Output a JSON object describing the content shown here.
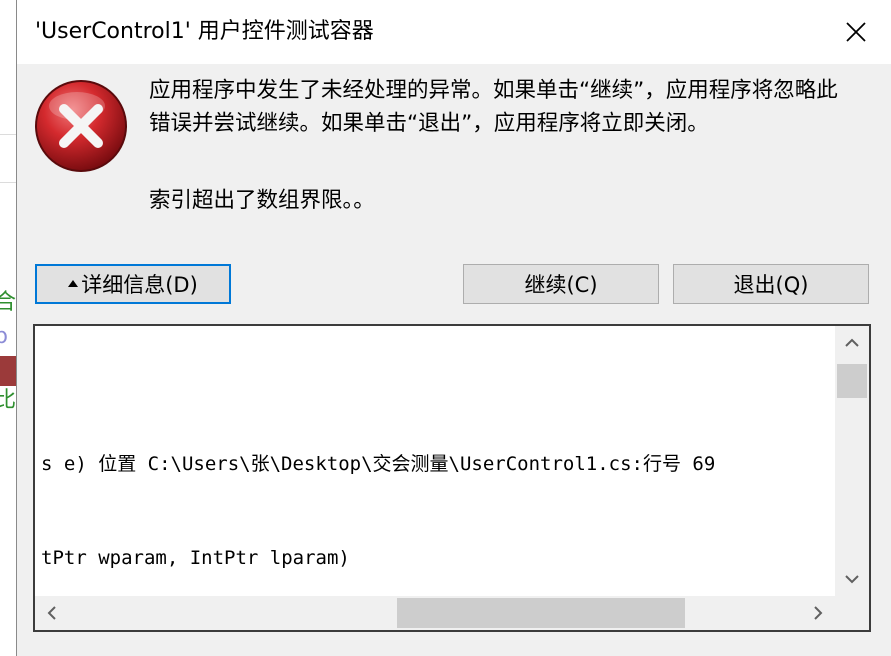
{
  "window": {
    "title": "'UserControl1' 用户控件测试容器"
  },
  "error": {
    "message": "应用程序中发生了未经处理的异常。如果单击“继续”，应用程序将忽略此错误并尝试继续。如果单击“退出”，应用程序将立即关闭。",
    "detail": "索引超出了数组界限。。"
  },
  "buttons": {
    "details_label": "详细信息(D)",
    "continue_label": "继续(C)",
    "quit_label": "退出(Q)"
  },
  "details_text": {
    "line1": "s e) 位置 C:\\Users\\张\\Desktop\\交会测量\\UserControl1.cs:行号 69",
    "line2": "tPtr wparam, IntPtr lparam)"
  },
  "background": {
    "chars": [
      "合",
      "b",
      "比"
    ]
  },
  "colors": {
    "focus_border": "#0078d7",
    "error_red": "#c8102e"
  }
}
